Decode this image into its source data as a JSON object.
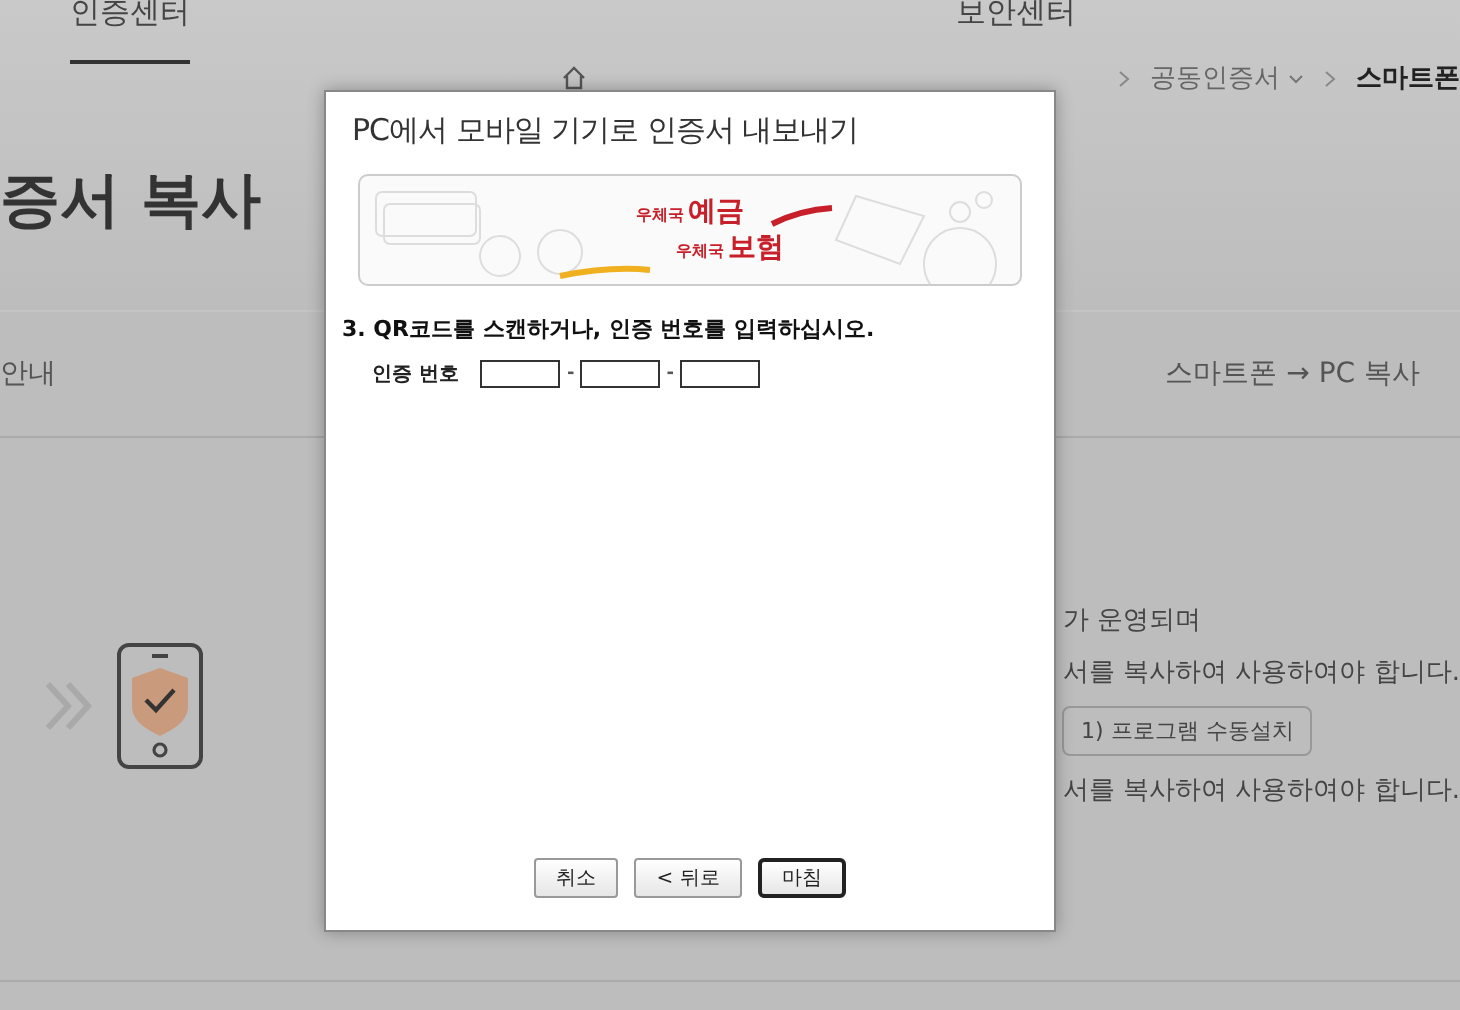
{
  "page": {
    "nav": [
      {
        "label": "인증센터",
        "selected": true
      },
      {
        "label": "보안센터",
        "selected": false
      }
    ],
    "breadcrumb": [
      {
        "label": "공동인증서",
        "dropdown": true,
        "current": false
      },
      {
        "label": "스마트폰",
        "dropdown": false,
        "current": true
      }
    ],
    "heading": "증서 복사",
    "band": {
      "left": "안내",
      "right": "스마트폰 → PC 복사"
    },
    "content": {
      "lines": [
        "가 운영되며",
        "서를 복사하여 사용하여야 합니다."
      ],
      "button": "1) 프로그램 수동설치",
      "note": "서를 복사하여 사용하여야 합니다."
    }
  },
  "dialog": {
    "title": "PC에서 모바일 기기로 인증서 내보내기",
    "banner": [
      {
        "small": "우체국",
        "big": "예금"
      },
      {
        "small": "우체국",
        "big": "보험"
      }
    ],
    "step": "3. QR코드를 스캔하거나, 인증 번호를 입력하십시오.",
    "code_label": "인증 번호",
    "separator": "-",
    "buttons": [
      {
        "label": "취소",
        "default": false
      },
      {
        "label": "< 뒤로",
        "default": false
      },
      {
        "label": "마침",
        "default": true
      }
    ]
  }
}
